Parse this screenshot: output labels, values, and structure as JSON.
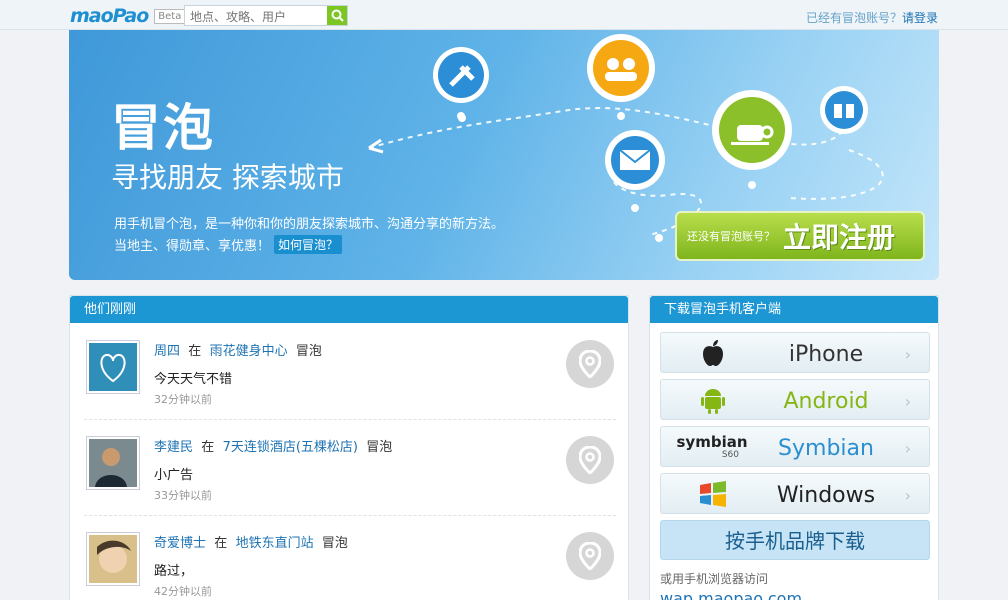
{
  "topbar": {
    "logo_text": "maoPao",
    "logo_badge": "Beta",
    "search_placeholder": "地点、攻略、用户",
    "login_prompt": "已经有冒泡账号？",
    "login_link": "请登录"
  },
  "banner": {
    "title": "冒泡",
    "subtitle": "寻找朋友 探索城市",
    "desc_line1": "用手机冒个泡，是一种你和你的朋友探索城市、沟通分享的新方法。",
    "desc_line2": "当地主、得勋章、享优惠！",
    "how_link": "如何冒泡？",
    "register_prompt": "还没有冒泡账号？",
    "register_button": "立即注册"
  },
  "feed": {
    "heading": "他们刚刚",
    "in_word": "在",
    "action_word": "冒泡",
    "items": [
      {
        "user": "周四",
        "place": "雨花健身中心",
        "message": "今天天气不错",
        "time": "32分钟以前"
      },
      {
        "user": "李建民",
        "place": "7天连锁酒店(五棵松店)",
        "message": "小广告",
        "time": "33分钟以前"
      },
      {
        "user": "奇爱博士",
        "place": "地铁东直门站",
        "message": "路过，",
        "time": "42分钟以前"
      }
    ]
  },
  "download": {
    "heading": "下载冒泡手机客户端",
    "platforms": [
      {
        "label": "iPhone",
        "icon": "apple-icon",
        "color": "#333333"
      },
      {
        "label": "Android",
        "icon": "android-icon",
        "color": "#86b614"
      },
      {
        "label": "Symbian",
        "icon": "symbian-icon",
        "color": "#2a8fd0"
      },
      {
        "label": "Windows",
        "icon": "windows-icon",
        "color": "#222222"
      }
    ],
    "symbian_logo_text": "symbian",
    "symbian_logo_sub": "S60",
    "brand_button": "按手机品牌下载",
    "wap_note": "或用手机浏览器访问",
    "wap_url": "wap.maopao.com"
  },
  "colors": {
    "accent": "#1d96d4",
    "link": "#1e73b4",
    "register_green": "#8cc02a"
  }
}
